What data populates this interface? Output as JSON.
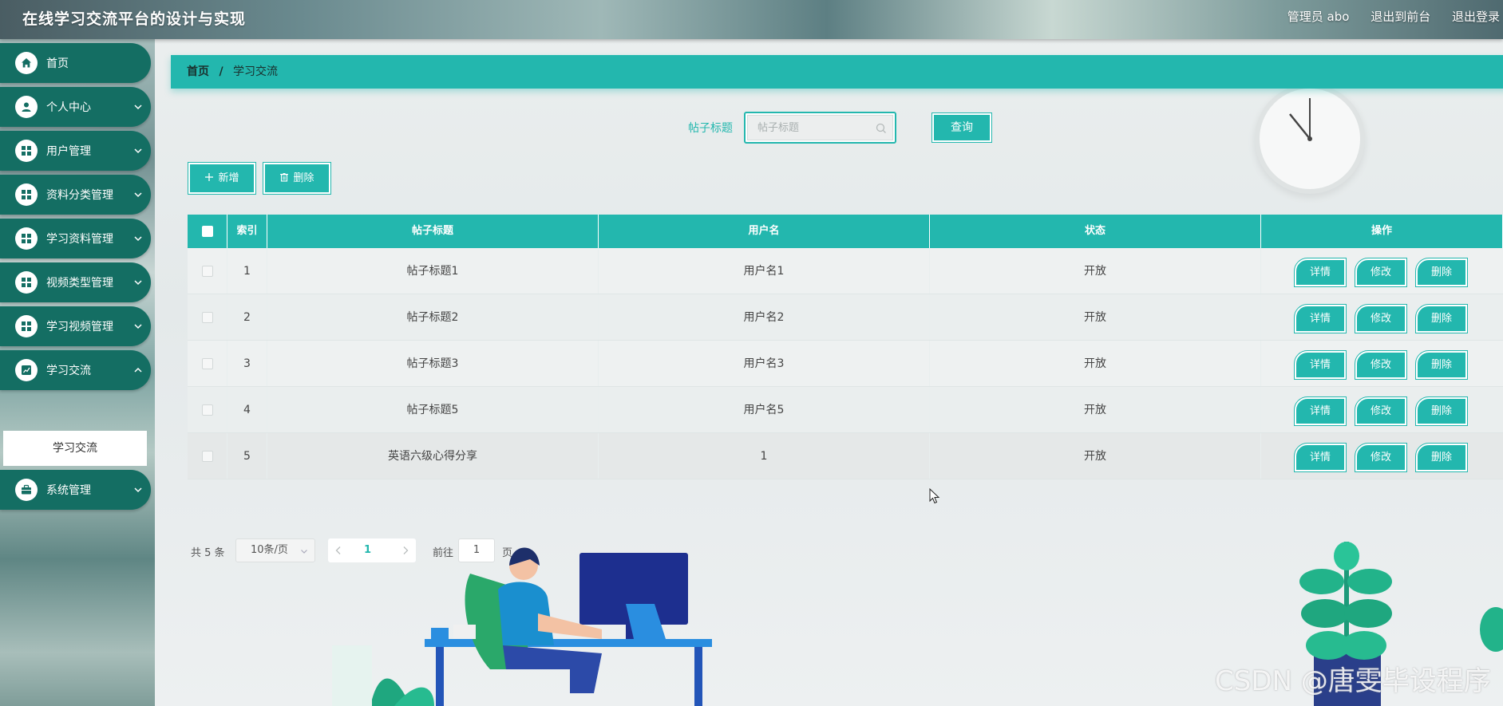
{
  "header": {
    "title": "在线学习交流平台的设计与实现",
    "user_label": "管理员 abo",
    "front_link": "退出到前台",
    "logout_link": "退出登录"
  },
  "sidebar": {
    "items": [
      {
        "label": "首页",
        "icon": "home-icon"
      },
      {
        "label": "个人中心",
        "icon": "user-icon"
      },
      {
        "label": "用户管理",
        "icon": "grid-icon"
      },
      {
        "label": "资料分类管理",
        "icon": "grid-icon"
      },
      {
        "label": "学习资料管理",
        "icon": "grid-icon"
      },
      {
        "label": "视频类型管理",
        "icon": "grid-icon"
      },
      {
        "label": "学习视频管理",
        "icon": "grid-icon"
      },
      {
        "label": "学习交流",
        "icon": "chart-icon"
      },
      {
        "label": "系统管理",
        "icon": "briefcase-icon"
      }
    ],
    "active_sub": "学习交流"
  },
  "breadcrumb": {
    "home": "首页",
    "separator": "/",
    "current": "学习交流"
  },
  "search": {
    "label": "帖子标题",
    "placeholder": "帖子标题",
    "button": "查询"
  },
  "actions": {
    "add": "新增",
    "delete": "删除"
  },
  "table": {
    "columns": [
      "索引",
      "帖子标题",
      "用户名",
      "状态",
      "操作"
    ],
    "rows": [
      {
        "index": "1",
        "title": "帖子标题1",
        "user": "用户名1",
        "status": "开放"
      },
      {
        "index": "2",
        "title": "帖子标题2",
        "user": "用户名2",
        "status": "开放"
      },
      {
        "index": "3",
        "title": "帖子标题3",
        "user": "用户名3",
        "status": "开放"
      },
      {
        "index": "4",
        "title": "帖子标题5",
        "user": "用户名5",
        "status": "开放"
      },
      {
        "index": "5",
        "title": "英语六级心得分享",
        "user": "1",
        "status": "开放"
      }
    ],
    "row_ops": {
      "detail": "详情",
      "edit": "修改",
      "delete": "删除"
    }
  },
  "pagination": {
    "total": "共 5 条",
    "page_size": "10条/页",
    "current_page": "1",
    "goto_prefix": "前往",
    "goto_value": "1",
    "goto_suffix": "页"
  },
  "watermark": "CSDN @唐雯毕设程序",
  "colors": {
    "accent": "#23b7ae",
    "menu_bg": "#146e63",
    "menu_text": "#ffffff"
  }
}
